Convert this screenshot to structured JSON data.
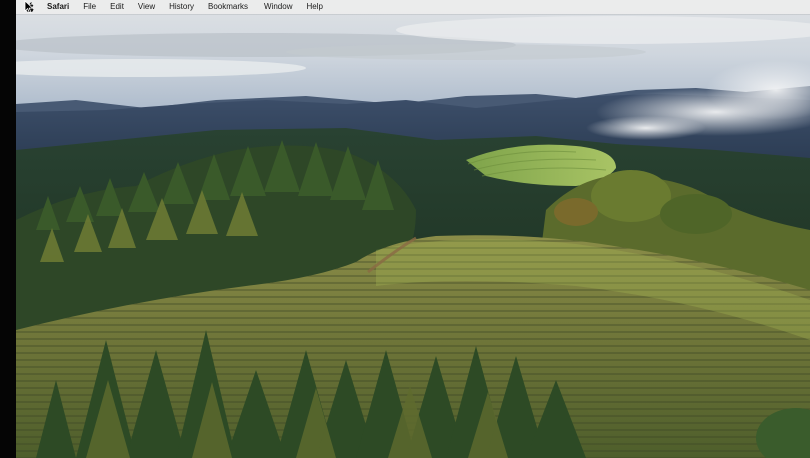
{
  "menubar": {
    "apple_icon": "apple-icon",
    "app_name": "Safari",
    "items": [
      {
        "label": "File"
      },
      {
        "label": "Edit"
      },
      {
        "label": "View"
      },
      {
        "label": "History"
      },
      {
        "label": "Bookmarks"
      },
      {
        "label": "Window"
      },
      {
        "label": "Help"
      }
    ]
  },
  "desktop": {
    "wallpaper": "vineyard-hills-landscape",
    "colors": {
      "sky": "#d9dde2",
      "mountains": "#31435a",
      "vineyard": "#6e7b3c",
      "forest": "#2f4b27"
    }
  },
  "cursor": {
    "icon": "pointer-cursor-icon"
  }
}
